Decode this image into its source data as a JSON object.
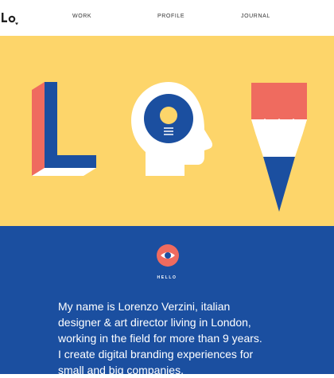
{
  "header": {
    "logo_text": "LO",
    "nav": [
      {
        "label": "WORK"
      },
      {
        "label": "PROFILE"
      },
      {
        "label": "JOURNAL"
      }
    ]
  },
  "hero": {
    "letters": [
      "L",
      "O",
      "V"
    ],
    "colors": {
      "background": "#fdd56a",
      "blue": "#1b4fa0",
      "red": "#ef6b5f",
      "white": "#ffffff"
    },
    "icons": [
      "letter-l-graphic",
      "head-bulb-icon",
      "pencil-icon"
    ]
  },
  "about": {
    "heading": "HELLO",
    "badge_icon": "eye-icon",
    "bio_lines": [
      "My name is Lorenzo Verzini, italian",
      "designer & art director living in London,",
      "working in the field for more than 9 years.",
      "I create digital branding experiences for",
      "small and big companies."
    ],
    "colors": {
      "background": "#1b4fa0",
      "text": "#ffffff"
    }
  }
}
